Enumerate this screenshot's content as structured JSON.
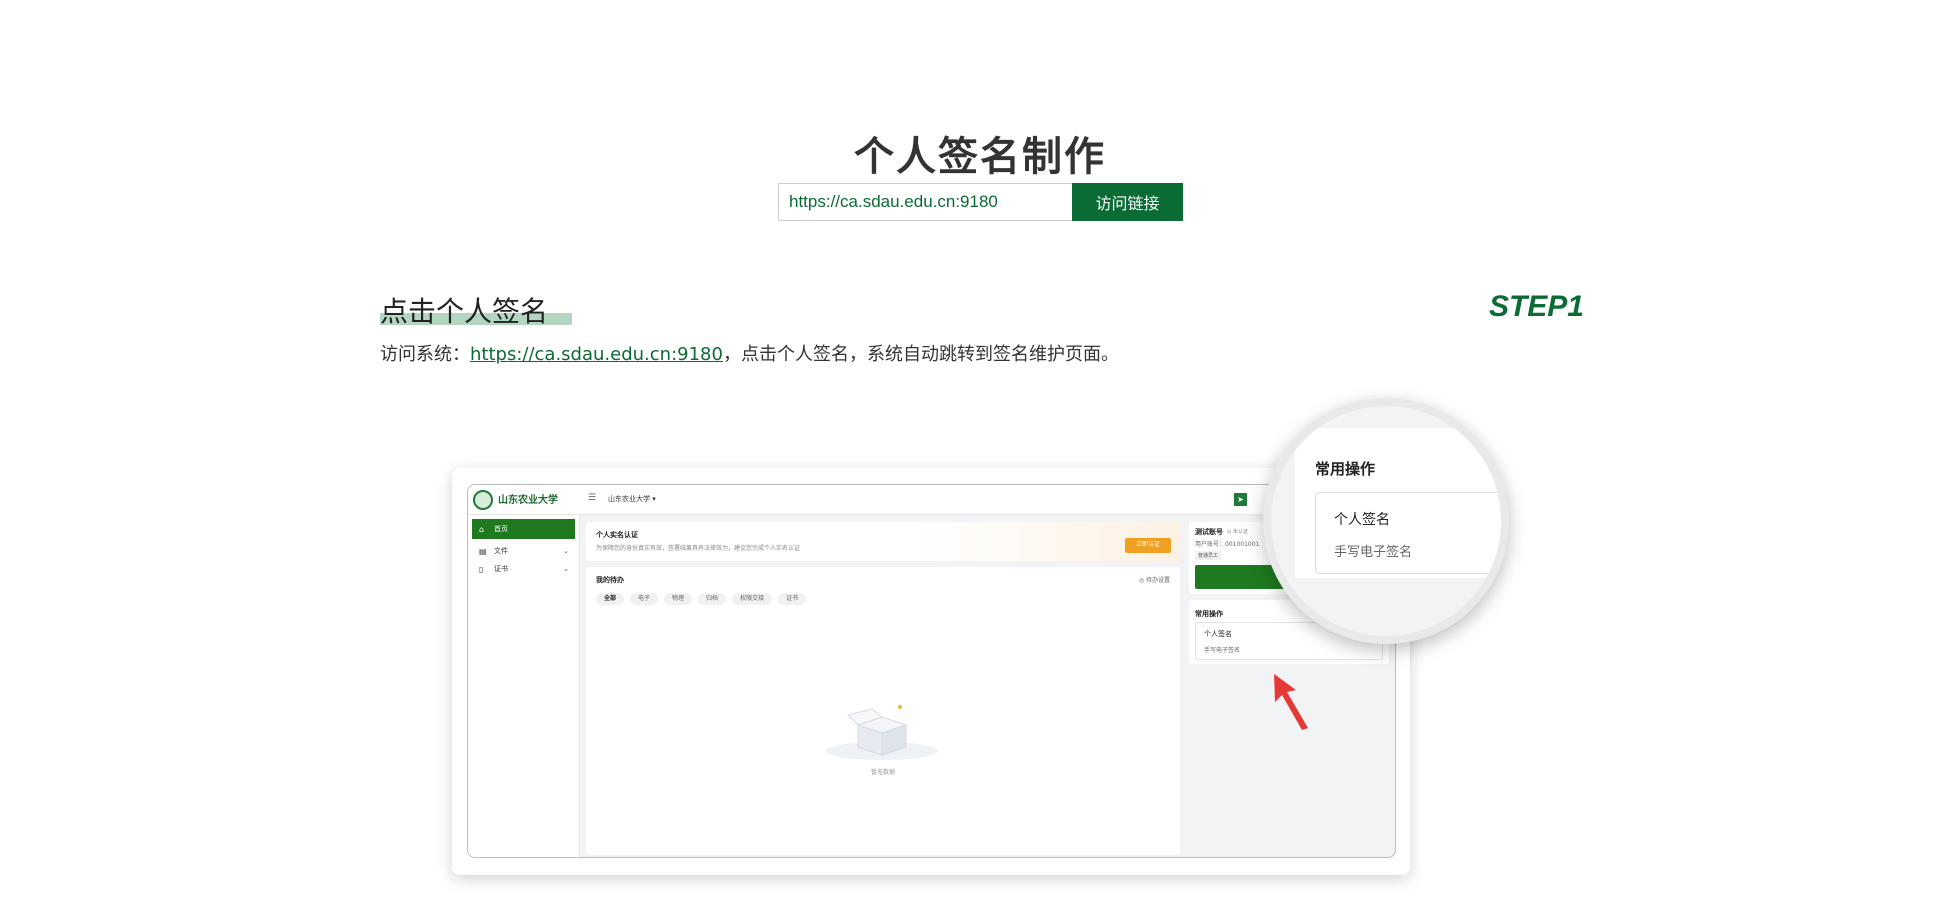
{
  "hero": {
    "title": "个人签名制作",
    "url_value": "https://ca.sdau.edu.cn:9180",
    "visit_button": "访问链接"
  },
  "step": {
    "title": "点击个人签名",
    "badge": "STEP1",
    "desc_prefix": "访问系统：",
    "desc_link": "https://ca.sdau.edu.cn:9180",
    "desc_suffix": "，点击个人签名，系统自动跳转到签名维护页面。"
  },
  "screenshot": {
    "logo_text": "山东农业大学",
    "org_select": "山东农业大学 ▾",
    "sidebar": [
      {
        "label": "首页",
        "icon": "home-icon",
        "active": true
      },
      {
        "label": "文件",
        "icon": "file-icon",
        "active": false
      },
      {
        "label": "证书",
        "icon": "certificate-icon",
        "active": false
      }
    ],
    "banner": {
      "title": "个人实名认证",
      "desc": "为保障您的身份真实有效，签署结果具有法律效力，建议您完成个人实名认证",
      "button": "立即认证"
    },
    "todo": {
      "title": "我的待办",
      "setting": "◎ 待办设置",
      "tabs": [
        "全部",
        "电子",
        "物理",
        "归档",
        "权限交接",
        "证书"
      ],
      "empty": "暂无数据"
    },
    "user": {
      "name": "测试账号",
      "auth": "◎ 未认证",
      "account": "用户账号：001001001",
      "tag": "普通员工"
    },
    "ops": {
      "title": "常用操作",
      "item1": "个人签名",
      "item2": "手写电子签名"
    }
  },
  "magnifier": {
    "title": "常用操作",
    "item1": "个人签名",
    "item2": "手写电子签名"
  },
  "colors": {
    "brand_green": "#0b6b35",
    "accent_orange": "#f0a020",
    "arrow_red": "#e53935"
  }
}
